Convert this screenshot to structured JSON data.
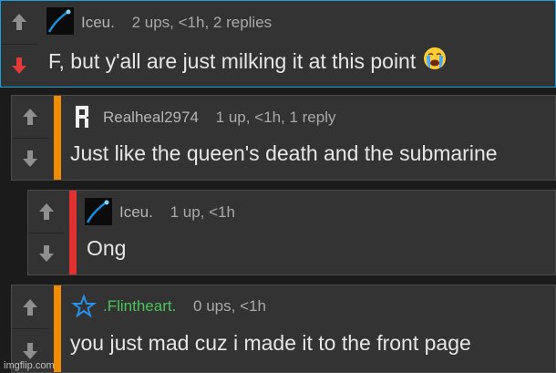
{
  "comments": [
    {
      "username": "Iceu.",
      "meta": "2 ups, <1h, 2 replies",
      "text": "F, but y'all are just milking it at this point",
      "emoji": "loudly-crying-face",
      "vote": "downvoted",
      "avatar": "blue-streak-avatar",
      "color": "#19a0d8"
    },
    {
      "username": "Realheal2974",
      "meta": "1 up, <1h, 1 reply",
      "text": "Just like the queen's death and the submarine",
      "avatar": "pixel-letter-avatar",
      "color": "#f08c00"
    },
    {
      "username": "Iceu.",
      "meta": "1 up, <1h",
      "text": "Ong",
      "avatar": "blue-streak-avatar",
      "color": "#e03030"
    },
    {
      "username": ".Flintheart.",
      "meta": "0 ups, <1h",
      "text": "you just mad cuz i made it to the front page",
      "avatar": "star-outline-avatar",
      "color": "#f08c00",
      "username_color": "#49c45a"
    }
  ],
  "watermark": "imgflip.com"
}
